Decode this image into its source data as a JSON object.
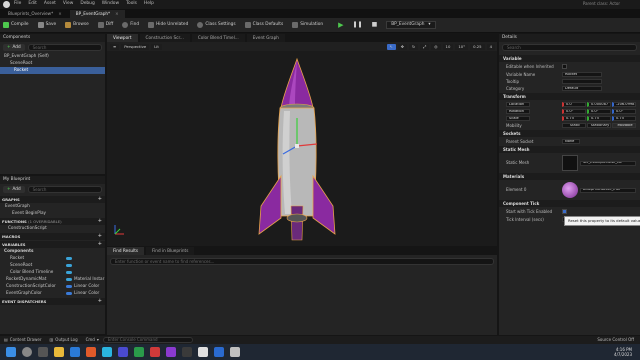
{
  "menu": {
    "items": [
      "File",
      "Edit",
      "Asset",
      "View",
      "Debug",
      "Window",
      "Tools",
      "Help"
    ],
    "project": "Parent class: Actor"
  },
  "tabs": [
    {
      "label": "Blueprints_Overview*"
    },
    {
      "label": "BP_EventGraph*"
    }
  ],
  "toolbar": {
    "compile": "Compile",
    "save": "Save",
    "browse": "Browse",
    "diff": "Diff",
    "find": "Find",
    "hide_unrelated": "Hide Unrelated",
    "class_settings": "Class Settings",
    "class_defaults": "Class Defaults",
    "simulation": "Simulation",
    "debug_target": "BP_EventGraph"
  },
  "components": {
    "title": "Components",
    "add": "Add",
    "search_placeholder": "Search",
    "items": [
      "BP_EventGraph (Self)",
      "SceneRoot",
      "Rocket"
    ]
  },
  "my_blueprint": {
    "title": "My Blueprint",
    "add": "Add",
    "search_placeholder": "Search",
    "graphs_label": "GRAPHS",
    "graph": "EventGraph",
    "graph_event": "Event BeginPlay",
    "functions_label": "FUNCTIONS",
    "function_count": "(1 OVERRIDABLE)",
    "function": "ConstructionScript",
    "macros_label": "MACROS",
    "variables_label": "VARIABLES",
    "components_label": "Components",
    "variables": [
      {
        "name": "Rocket",
        "type": ""
      },
      {
        "name": "SceneRoot",
        "type": ""
      },
      {
        "name": "Color Blend Timeline",
        "type": ""
      },
      {
        "name": "RocketDynamicMat",
        "type": "Material Instar"
      },
      {
        "name": "ConstructionScriptColor",
        "type": "Linear Color"
      },
      {
        "name": "EventGraphColor",
        "type": "Linear Color"
      }
    ],
    "dispatchers_label": "EVENT DISPATCHERS"
  },
  "viewport": {
    "tabs": [
      "Viewport",
      "Construction Scr...",
      "Color Blend Timel...",
      "Event Graph"
    ],
    "perspective": "Perspective",
    "lit": "Lit",
    "snap": "10",
    "angle": "10°",
    "scale": "0.25",
    "cam": "4"
  },
  "find": {
    "tabs": [
      "Find Results",
      "Find in Blueprints"
    ],
    "placeholder": "Enter function or event name to find references..."
  },
  "details": {
    "title": "Details",
    "search_placeholder": "Search",
    "variable_sec": "Variable",
    "editable": "Editable when Inherited",
    "var_name_label": "Variable Name",
    "var_name": "Rocket",
    "tooltip_label": "Tooltip",
    "category_label": "Category",
    "category": "Default",
    "transform_sec": "Transform",
    "location_label": "Location",
    "location": [
      "0.0",
      "0.000087",
      "-206.0998"
    ],
    "rotation_label": "Rotation",
    "rotation": [
      "0.0°",
      "0.0°",
      "0.0°"
    ],
    "scale_label": "Scale",
    "scale": [
      "0.75",
      "0.75",
      "0.75"
    ],
    "mobility_label": "Mobility",
    "mobility": [
      "Static",
      "Stationary",
      "Movable"
    ],
    "sockets_sec": "Sockets",
    "parent_socket_label": "Parent Socket",
    "parent_socket": "None",
    "static_mesh_sec": "Static Mesh",
    "static_mesh_label": "Static Mesh",
    "static_mesh": "SM_ExampleMesh_Ro",
    "materials_sec": "Materials",
    "element_label": "Element 0",
    "element": "BlueprintRocket_Inst",
    "tooltip_text": "Reset this property to its default value",
    "tick_sec": "Component Tick",
    "tick_enabled": "Start with Tick Enabled",
    "tick_interval_label": "Tick Interval (secs)",
    "tick_interval": "0.0"
  },
  "status": {
    "content_drawer": "Content Drawer",
    "output_log": "Output Log",
    "cmd": "Cmd",
    "console_placeholder": "Enter Console Command",
    "source_control": "Source Control Off"
  },
  "clock": {
    "time": "4:16 PM",
    "date": "4/7/2023"
  }
}
